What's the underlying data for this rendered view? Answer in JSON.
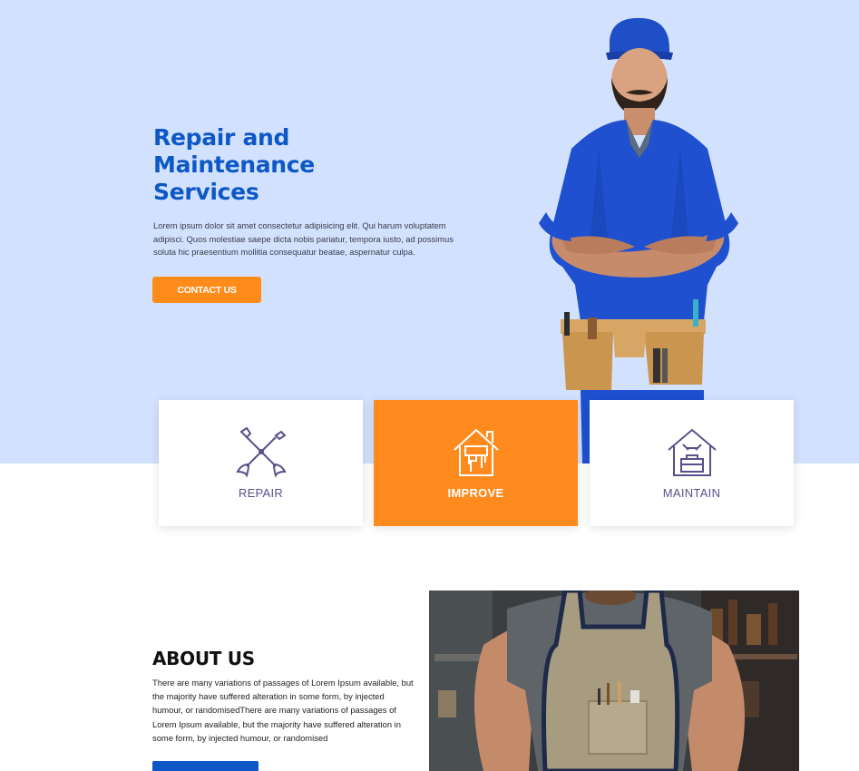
{
  "hero": {
    "title": "Repair and\nMaintenance\nServices",
    "text": "Lorem ipsum dolor sit amet consectetur adipisicing elit. Qui harum voluptatem adipisci. Quos molestiae saepe dicta nobis pariatur, tempora iusto, ad possimus soluta hic praesentium mollitia consequatur beatae, aspernatur culpa.",
    "cta_label": "CONTACT US",
    "photo_icon": "worker-with-tool-belt"
  },
  "services": [
    {
      "label": "REPAIR",
      "icon": "crossed-wrenches-icon",
      "active": false
    },
    {
      "label": "IMPROVE",
      "icon": "house-paint-roller-icon",
      "active": true
    },
    {
      "label": "MAINTAIN",
      "icon": "house-toolbox-icon",
      "active": false
    }
  ],
  "about": {
    "title": "ABOUT US",
    "text": "There are many variations of passages of Lorem Ipsum available, but the majority have suffered alteration in some form, by injected humour, or randomisedThere are many variations of passages of Lorem Ipsum available, but the majority have suffered alteration in some form, by injected humour, or randomised",
    "photo_icon": "craftsman-in-apron"
  },
  "colors": {
    "hero_bg": "#d2e2fe",
    "brand_blue": "#0d58c6",
    "accent_orange": "#ff8a1e",
    "icon_purple": "#5a4f8a"
  }
}
